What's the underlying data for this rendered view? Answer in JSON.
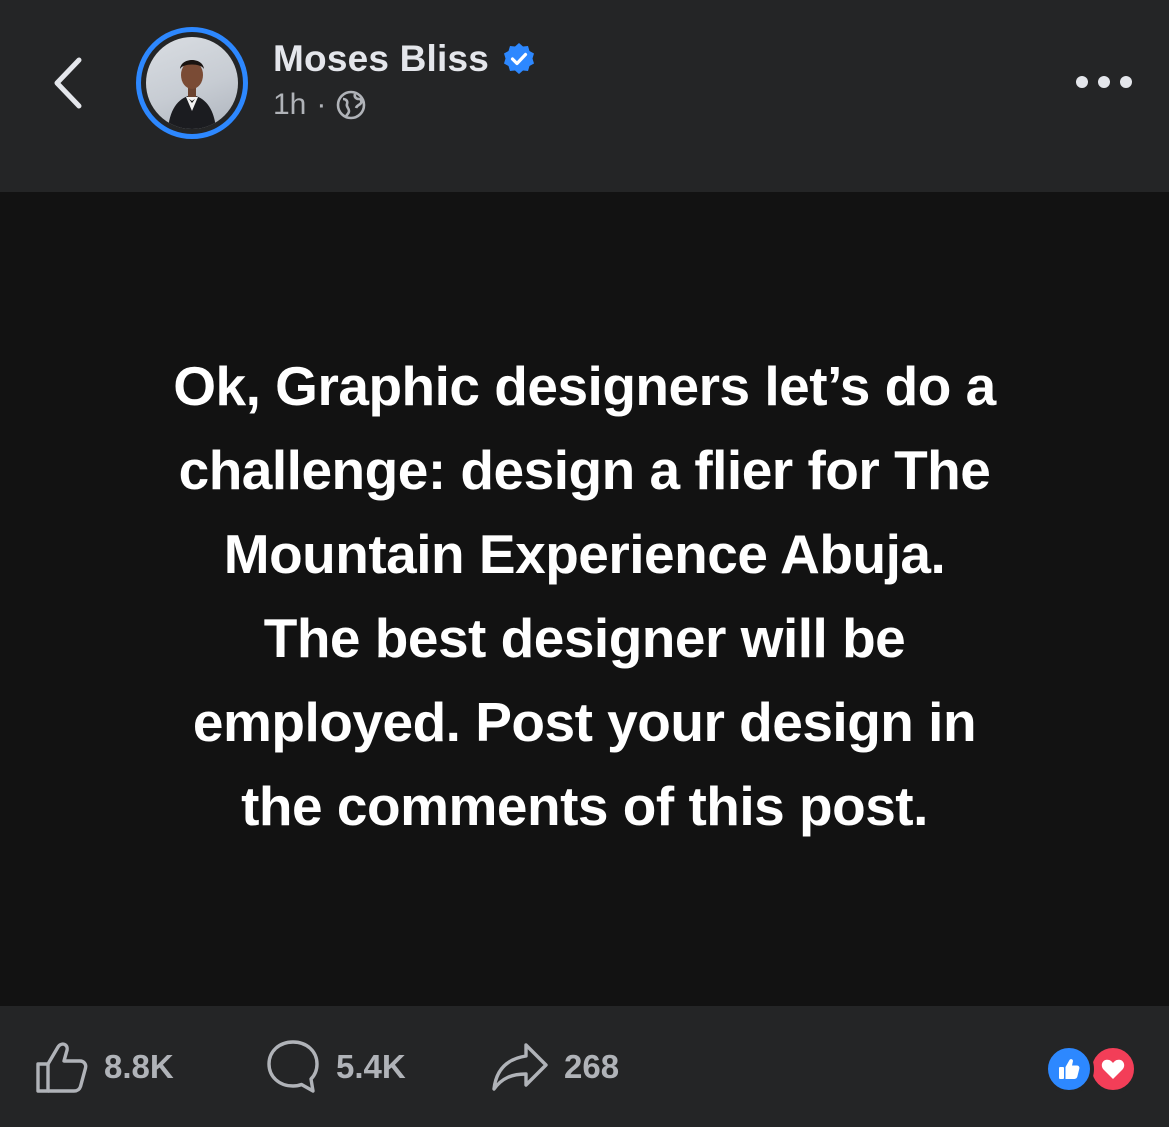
{
  "header": {
    "author_name": "Moses Bliss",
    "timestamp": "1h",
    "separator": "·",
    "privacy_icon": "globe-icon",
    "verified_icon": "verified-badge-icon",
    "back_icon": "chevron-left-icon",
    "more_icon": "more-options-icon"
  },
  "post": {
    "text": "Ok, Graphic designers let’s do a\nchallenge: design a flier for The\nMountain  Experience Abuja.\nThe best designer will be\nemployed. Post your design in\nthe comments of this post."
  },
  "footer": {
    "like_count": "8.8K",
    "comment_count": "5.4K",
    "share_count": "268",
    "reaction_icons": [
      "like-reaction-icon",
      "love-reaction-icon"
    ]
  },
  "colors": {
    "background": "#242526",
    "post_background": "#121212",
    "accent": "#2d88ff",
    "love": "#f33e58",
    "secondary_text": "#b0b3b8"
  }
}
